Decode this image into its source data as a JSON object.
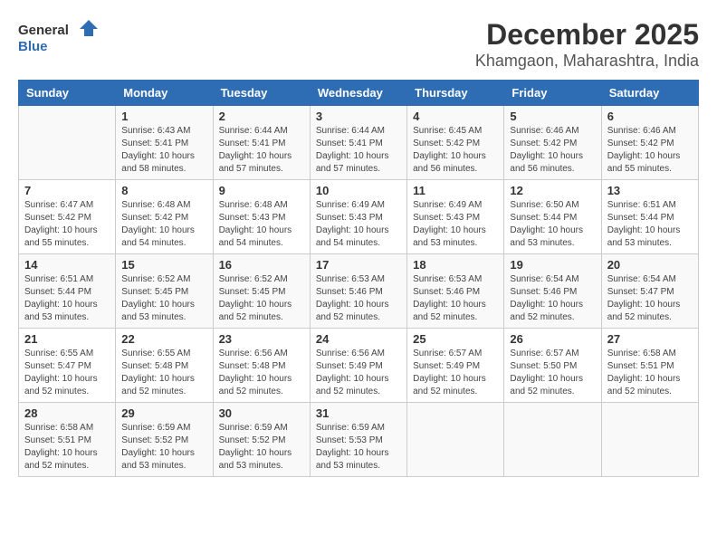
{
  "header": {
    "logo_line1": "General",
    "logo_line2": "Blue",
    "title": "December 2025",
    "subtitle": "Khamgaon, Maharashtra, India"
  },
  "weekdays": [
    "Sunday",
    "Monday",
    "Tuesday",
    "Wednesday",
    "Thursday",
    "Friday",
    "Saturday"
  ],
  "weeks": [
    [
      {
        "day": "",
        "sunrise": "",
        "sunset": "",
        "daylight": ""
      },
      {
        "day": "1",
        "sunrise": "Sunrise: 6:43 AM",
        "sunset": "Sunset: 5:41 PM",
        "daylight": "Daylight: 10 hours and 58 minutes."
      },
      {
        "day": "2",
        "sunrise": "Sunrise: 6:44 AM",
        "sunset": "Sunset: 5:41 PM",
        "daylight": "Daylight: 10 hours and 57 minutes."
      },
      {
        "day": "3",
        "sunrise": "Sunrise: 6:44 AM",
        "sunset": "Sunset: 5:41 PM",
        "daylight": "Daylight: 10 hours and 57 minutes."
      },
      {
        "day": "4",
        "sunrise": "Sunrise: 6:45 AM",
        "sunset": "Sunset: 5:42 PM",
        "daylight": "Daylight: 10 hours and 56 minutes."
      },
      {
        "day": "5",
        "sunrise": "Sunrise: 6:46 AM",
        "sunset": "Sunset: 5:42 PM",
        "daylight": "Daylight: 10 hours and 56 minutes."
      },
      {
        "day": "6",
        "sunrise": "Sunrise: 6:46 AM",
        "sunset": "Sunset: 5:42 PM",
        "daylight": "Daylight: 10 hours and 55 minutes."
      }
    ],
    [
      {
        "day": "7",
        "sunrise": "Sunrise: 6:47 AM",
        "sunset": "Sunset: 5:42 PM",
        "daylight": "Daylight: 10 hours and 55 minutes."
      },
      {
        "day": "8",
        "sunrise": "Sunrise: 6:48 AM",
        "sunset": "Sunset: 5:42 PM",
        "daylight": "Daylight: 10 hours and 54 minutes."
      },
      {
        "day": "9",
        "sunrise": "Sunrise: 6:48 AM",
        "sunset": "Sunset: 5:43 PM",
        "daylight": "Daylight: 10 hours and 54 minutes."
      },
      {
        "day": "10",
        "sunrise": "Sunrise: 6:49 AM",
        "sunset": "Sunset: 5:43 PM",
        "daylight": "Daylight: 10 hours and 54 minutes."
      },
      {
        "day": "11",
        "sunrise": "Sunrise: 6:49 AM",
        "sunset": "Sunset: 5:43 PM",
        "daylight": "Daylight: 10 hours and 53 minutes."
      },
      {
        "day": "12",
        "sunrise": "Sunrise: 6:50 AM",
        "sunset": "Sunset: 5:44 PM",
        "daylight": "Daylight: 10 hours and 53 minutes."
      },
      {
        "day": "13",
        "sunrise": "Sunrise: 6:51 AM",
        "sunset": "Sunset: 5:44 PM",
        "daylight": "Daylight: 10 hours and 53 minutes."
      }
    ],
    [
      {
        "day": "14",
        "sunrise": "Sunrise: 6:51 AM",
        "sunset": "Sunset: 5:44 PM",
        "daylight": "Daylight: 10 hours and 53 minutes."
      },
      {
        "day": "15",
        "sunrise": "Sunrise: 6:52 AM",
        "sunset": "Sunset: 5:45 PM",
        "daylight": "Daylight: 10 hours and 53 minutes."
      },
      {
        "day": "16",
        "sunrise": "Sunrise: 6:52 AM",
        "sunset": "Sunset: 5:45 PM",
        "daylight": "Daylight: 10 hours and 52 minutes."
      },
      {
        "day": "17",
        "sunrise": "Sunrise: 6:53 AM",
        "sunset": "Sunset: 5:46 PM",
        "daylight": "Daylight: 10 hours and 52 minutes."
      },
      {
        "day": "18",
        "sunrise": "Sunrise: 6:53 AM",
        "sunset": "Sunset: 5:46 PM",
        "daylight": "Daylight: 10 hours and 52 minutes."
      },
      {
        "day": "19",
        "sunrise": "Sunrise: 6:54 AM",
        "sunset": "Sunset: 5:46 PM",
        "daylight": "Daylight: 10 hours and 52 minutes."
      },
      {
        "day": "20",
        "sunrise": "Sunrise: 6:54 AM",
        "sunset": "Sunset: 5:47 PM",
        "daylight": "Daylight: 10 hours and 52 minutes."
      }
    ],
    [
      {
        "day": "21",
        "sunrise": "Sunrise: 6:55 AM",
        "sunset": "Sunset: 5:47 PM",
        "daylight": "Daylight: 10 hours and 52 minutes."
      },
      {
        "day": "22",
        "sunrise": "Sunrise: 6:55 AM",
        "sunset": "Sunset: 5:48 PM",
        "daylight": "Daylight: 10 hours and 52 minutes."
      },
      {
        "day": "23",
        "sunrise": "Sunrise: 6:56 AM",
        "sunset": "Sunset: 5:48 PM",
        "daylight": "Daylight: 10 hours and 52 minutes."
      },
      {
        "day": "24",
        "sunrise": "Sunrise: 6:56 AM",
        "sunset": "Sunset: 5:49 PM",
        "daylight": "Daylight: 10 hours and 52 minutes."
      },
      {
        "day": "25",
        "sunrise": "Sunrise: 6:57 AM",
        "sunset": "Sunset: 5:49 PM",
        "daylight": "Daylight: 10 hours and 52 minutes."
      },
      {
        "day": "26",
        "sunrise": "Sunrise: 6:57 AM",
        "sunset": "Sunset: 5:50 PM",
        "daylight": "Daylight: 10 hours and 52 minutes."
      },
      {
        "day": "27",
        "sunrise": "Sunrise: 6:58 AM",
        "sunset": "Sunset: 5:51 PM",
        "daylight": "Daylight: 10 hours and 52 minutes."
      }
    ],
    [
      {
        "day": "28",
        "sunrise": "Sunrise: 6:58 AM",
        "sunset": "Sunset: 5:51 PM",
        "daylight": "Daylight: 10 hours and 52 minutes."
      },
      {
        "day": "29",
        "sunrise": "Sunrise: 6:59 AM",
        "sunset": "Sunset: 5:52 PM",
        "daylight": "Daylight: 10 hours and 53 minutes."
      },
      {
        "day": "30",
        "sunrise": "Sunrise: 6:59 AM",
        "sunset": "Sunset: 5:52 PM",
        "daylight": "Daylight: 10 hours and 53 minutes."
      },
      {
        "day": "31",
        "sunrise": "Sunrise: 6:59 AM",
        "sunset": "Sunset: 5:53 PM",
        "daylight": "Daylight: 10 hours and 53 minutes."
      },
      {
        "day": "",
        "sunrise": "",
        "sunset": "",
        "daylight": ""
      },
      {
        "day": "",
        "sunrise": "",
        "sunset": "",
        "daylight": ""
      },
      {
        "day": "",
        "sunrise": "",
        "sunset": "",
        "daylight": ""
      }
    ]
  ]
}
